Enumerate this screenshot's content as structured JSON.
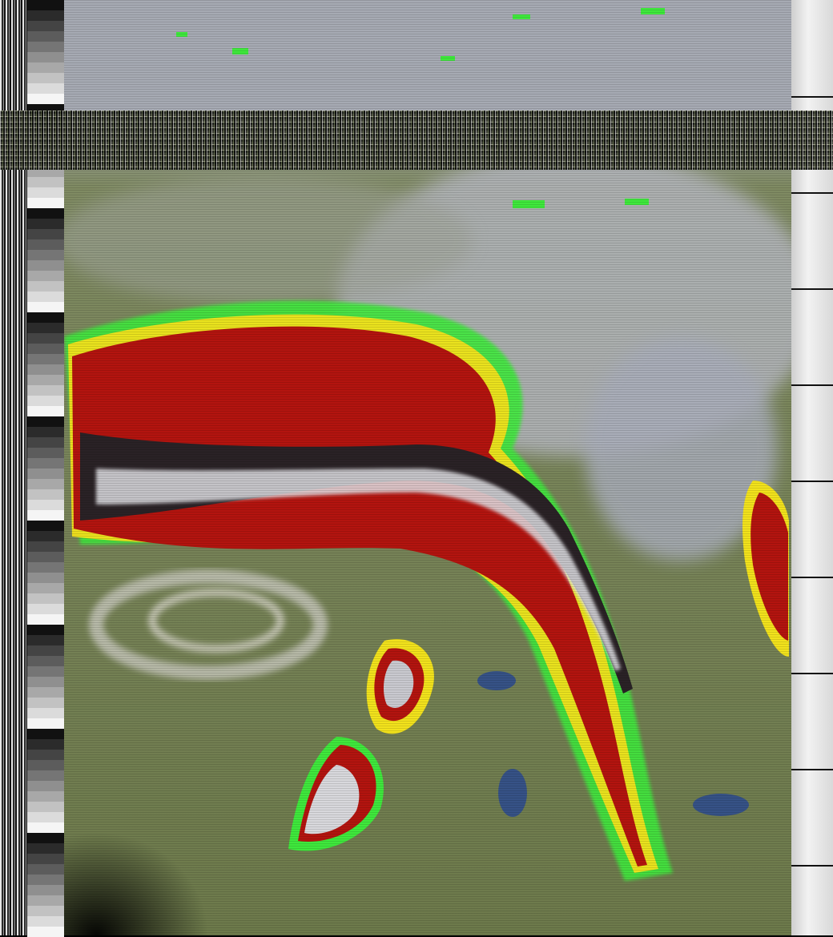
{
  "image": {
    "kind": "APT weather satellite image (false-color infrared/visible composite)",
    "palette": {
      "land": "#6e7a4c",
      "ocean": "#7d8a5a",
      "cloud_gray": "#b8bcc2",
      "cold_top_red": "#b3140f",
      "warm_rim_yellow": "#f2e21c",
      "edge_green": "#3fe83c",
      "dark_core": "#2a2226",
      "water_blue": "#2b4a8f"
    }
  }
}
